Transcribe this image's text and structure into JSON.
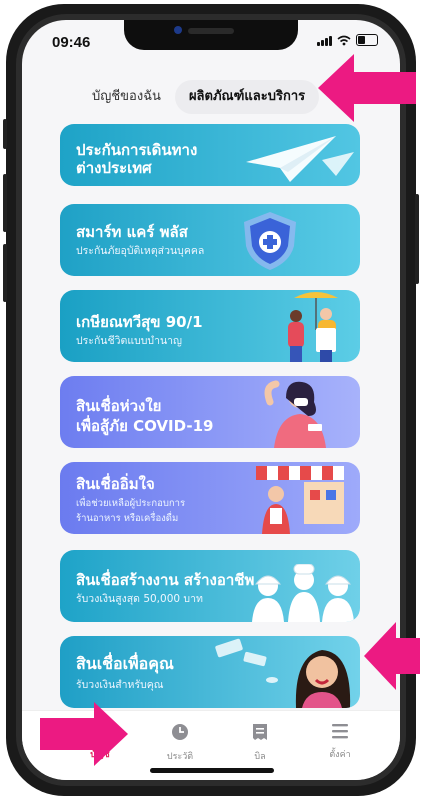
{
  "status": {
    "time": "09:46"
  },
  "tabs_top": [
    {
      "label": "บัญชีของฉัน"
    },
    {
      "label": "ผลิตภัณฑ์และบริการ"
    }
  ],
  "cards": [
    {
      "title": "ประกันการเดินทาง",
      "subtitle": "ต่างประเทศ",
      "color_from": "#1ea3c7",
      "color_to": "#52c6e3"
    },
    {
      "title": "สมาร์ท แคร์ พลัส",
      "subtitle": "ประกันภัยอุบัติเหตุส่วนบุคคล",
      "color_from": "#1fa1c6",
      "color_to": "#59cbe6"
    },
    {
      "title": "เกษียณทวีสุข 90/1",
      "subtitle": "ประกันชีวิตแบบบำนาญ",
      "color_from": "#1aa0c4",
      "color_to": "#5ccde6"
    },
    {
      "title": "สินเชื่อห่วงใย",
      "subtitle": "เพื่อสู้ภัย COVID-19",
      "color_from": "#6d7df0",
      "color_to": "#a7b2fb"
    },
    {
      "title": "สินเชื่ออิ่มใจ",
      "subtitle": "เพื่อช่วยเหลือผู้ประกอบการ",
      "subtitle2": "ร้านอาหาร หรือเครื่องดื่ม",
      "color_from": "#6b7bef",
      "color_to": "#9eaafa"
    },
    {
      "title": "สินเชื่อสร้างงาน สร้างอาชีพ",
      "subtitle": "รับวงเงินสูงสุด 50,000 บาท",
      "color_from": "#1ea3c8",
      "color_to": "#6fd0e8"
    },
    {
      "title": "สินเชื่อเพื่อคุณ",
      "subtitle": "รับวงเงินสำหรับคุณ",
      "color_from": "#1f9fc6",
      "color_to": "#72d2ea"
    }
  ],
  "bottom_tabs": [
    {
      "label": "บัญชี",
      "icon": "card-icon",
      "active": true
    },
    {
      "label": "ประวัติ",
      "icon": "clock-icon",
      "active": false
    },
    {
      "label": "บิล",
      "icon": "bill-icon",
      "active": false
    },
    {
      "label": "ตั้งค่า",
      "icon": "menu-icon",
      "active": false
    }
  ],
  "colors": {
    "accent": "#e0245e",
    "annotation_arrow": "#ec1a82"
  }
}
